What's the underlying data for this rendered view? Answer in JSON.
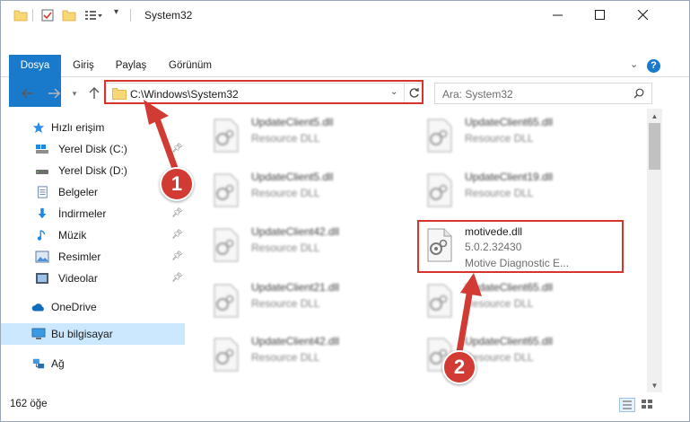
{
  "window": {
    "title": "System32",
    "controls": {
      "minimize": "—",
      "maximize": "☐",
      "close": "✕"
    }
  },
  "ribbon": {
    "tabs": [
      "Dosya",
      "Giriş",
      "Paylaş",
      "Görünüm"
    ]
  },
  "address_bar": {
    "path": "C:\\Windows\\System32",
    "search_placeholder": "Ara: System32"
  },
  "sidebar": {
    "items": [
      {
        "label": "Hızlı erişim",
        "icon": "star-icon"
      },
      {
        "label": "Yerel Disk (C:)",
        "icon": "drive-icon",
        "pinned": true
      },
      {
        "label": "Yerel Disk (D:)",
        "icon": "drive-icon"
      },
      {
        "label": "Belgeler",
        "icon": "document-icon",
        "pinned": true
      },
      {
        "label": "İndirmeler",
        "icon": "download-icon",
        "pinned": true
      },
      {
        "label": "Müzik",
        "icon": "music-icon",
        "pinned": true
      },
      {
        "label": "Resimler",
        "icon": "pictures-icon",
        "pinned": true
      },
      {
        "label": "Videolar",
        "icon": "video-icon",
        "pinned": true
      },
      {
        "label": "OneDrive",
        "icon": "cloud-icon"
      },
      {
        "label": "Bu bilgisayar",
        "icon": "computer-icon",
        "selected": true
      },
      {
        "label": "Ağ",
        "icon": "network-icon"
      }
    ]
  },
  "files": [
    {
      "name": "UpdateClient5.dll",
      "type": "Resource DLL",
      "blurred": true
    },
    {
      "name": "UpdateClient65.dll",
      "type": "Resource DLL",
      "blurred": true
    },
    {
      "name": "UpdateClient5.dll",
      "type": "Resource DLL",
      "blurred": true
    },
    {
      "name": "UpdateClient19.dll",
      "type": "Resource DLL",
      "blurred": true
    },
    {
      "name": "UpdateClient42.dll",
      "type": "Resource DLL",
      "blurred": true
    },
    {
      "name": "motivede.dll",
      "type": "5.0.2.32430",
      "description": "Motive Diagnostic E...",
      "blurred": false
    },
    {
      "name": "UpdateClient21.dll",
      "type": "Resource DLL",
      "blurred": true
    },
    {
      "name": "UpdateClient65.dll",
      "type": "Resource DLL",
      "blurred": true
    },
    {
      "name": "UpdateClient42.dll",
      "type": "Resource DLL",
      "blurred": true
    },
    {
      "name": "UpdateClient65.dll",
      "type": "Resource DLL",
      "blurred": true
    }
  ],
  "status": {
    "item_count": "162 öğe"
  },
  "annotations": {
    "step1": "1",
    "step2": "2",
    "color": "#d9342b"
  }
}
